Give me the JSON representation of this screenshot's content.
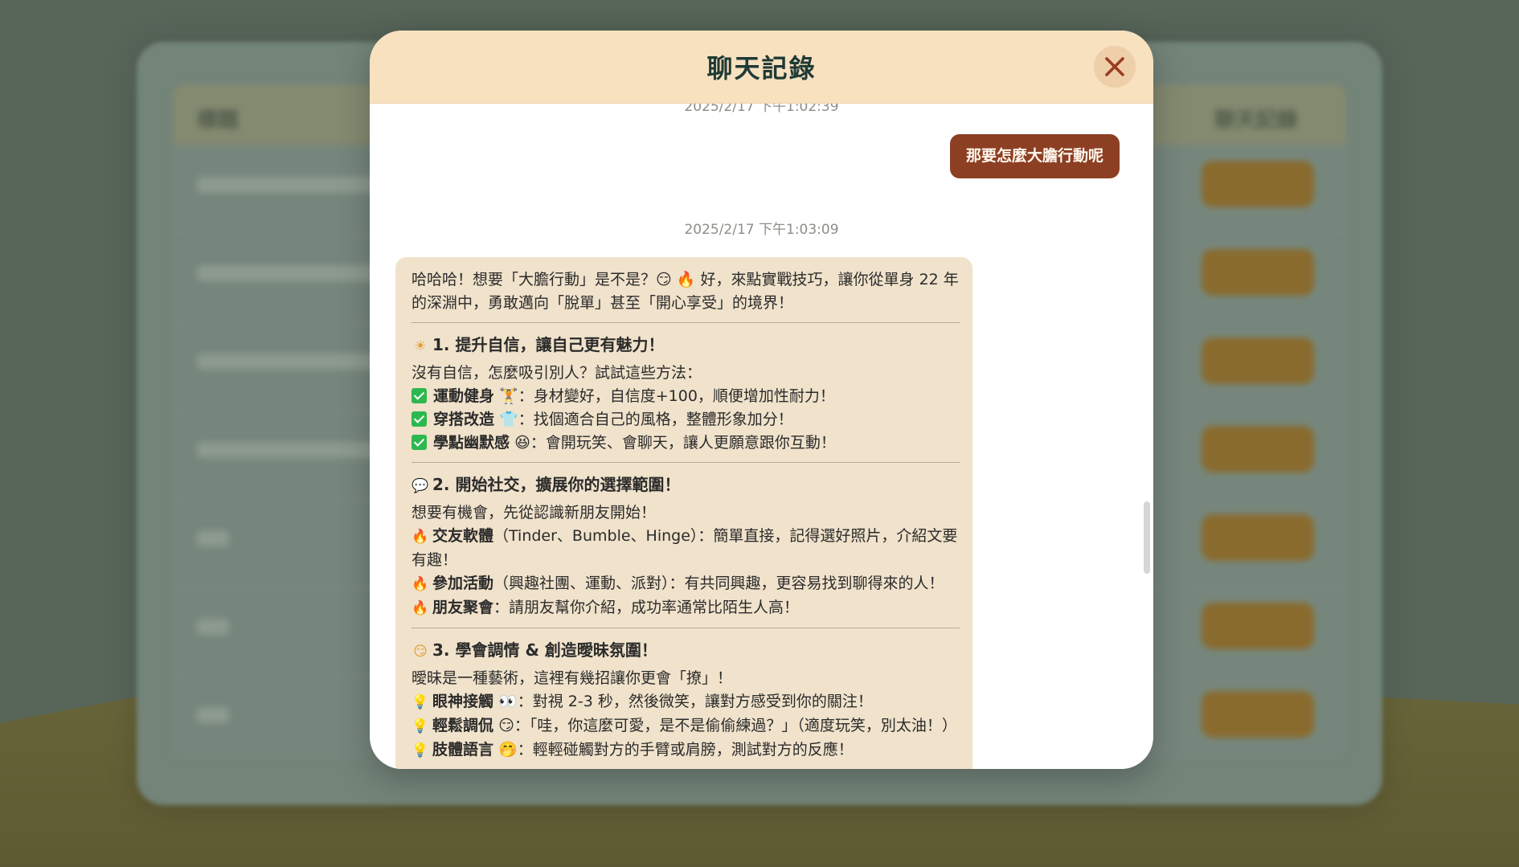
{
  "modal": {
    "title": "聊天記錄",
    "close_label": "×"
  },
  "chat": {
    "timestamp_top": "2025/2/17 下午1:02:39",
    "user_message": "那要怎麼大膽行動呢",
    "timestamp_reply": "2025/2/17 下午1:03:09",
    "reply": {
      "intro": "哈哈哈！想要「大膽行動」是不是？😏 🔥 好，來點實戰技巧，讓你從單身 22 年的深淵中，勇敢邁向「脫單」甚至「開心享受」的境界！",
      "sections": [
        {
          "icon": "☀",
          "heading": "1. 提升自信，讓自己更有魅力！",
          "lead": "沒有自信，怎麼吸引別人？試試這些方法：",
          "items": [
            {
              "marker": "check",
              "bold": "運動健身",
              "emoji": "🏋",
              "text": "：身材變好，自信度+100，順便增加性耐力！"
            },
            {
              "marker": "check",
              "bold": "穿搭改造",
              "emoji": "👕",
              "text": "：找個適合自己的風格，整體形象加分！"
            },
            {
              "marker": "check",
              "bold": "學點幽默感",
              "emoji": "😆",
              "text": "：會開玩笑、會聊天，讓人更願意跟你互動！"
            }
          ]
        },
        {
          "icon": "💬",
          "heading": "2. 開始社交，擴展你的選擇範圍！",
          "lead": "想要有機會，先從認識新朋友開始！",
          "items": [
            {
              "marker": "🔥",
              "bold": "交友軟體",
              "emoji": "",
              "text": "（Tinder、Bumble、Hinge）：簡單直接，記得選好照片，介紹文要有趣！"
            },
            {
              "marker": "🔥",
              "bold": "參加活動",
              "emoji": "",
              "text": "（興趣社團、運動、派對）：有共同興趣，更容易找到聊得來的人！"
            },
            {
              "marker": "🔥",
              "bold": "朋友聚會",
              "emoji": "",
              "text": "：請朋友幫你介紹，成功率通常比陌生人高！"
            }
          ]
        },
        {
          "icon": "😏",
          "heading": "3. 學會調情 & 創造曖昧氛圍！",
          "lead": "曖昧是一種藝術，這裡有幾招讓你更會「撩」！",
          "items": [
            {
              "marker": "💡",
              "bold": "眼神接觸",
              "emoji": "👀",
              "text": "：對視 2-3 秒，然後微笑，讓對方感受到你的關注！"
            },
            {
              "marker": "💡",
              "bold": "輕鬆調侃",
              "emoji": "😏",
              "text": "：「哇，你這麼可愛，是不是偷偷練過？」（適度玩笑，別太油！）"
            },
            {
              "marker": "💡",
              "bold": "肢體語言",
              "emoji": "🤭",
              "text": "：輕輕碰觸對方的手臂或肩膀，測試對方的反應！"
            }
          ]
        }
      ]
    }
  },
  "background": {
    "col_left": "標題",
    "col_right": "聊天記錄"
  },
  "colors": {
    "header_bg": "#f7e1bf",
    "user_bubble": "#8d3f23",
    "bot_bubble": "#f0e2cb",
    "title_text": "#1f3a36"
  }
}
